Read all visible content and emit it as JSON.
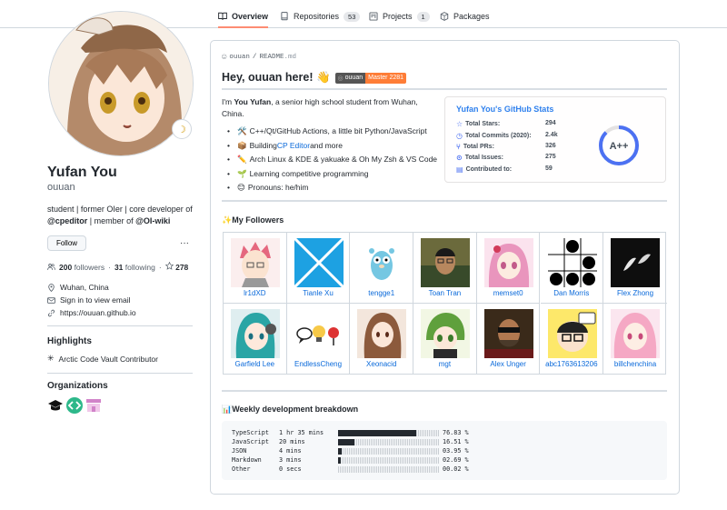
{
  "tabs": [
    {
      "label": "Overview",
      "icon": "book-icon"
    },
    {
      "label": "Repositories",
      "count": "53",
      "icon": "repo-icon"
    },
    {
      "label": "Projects",
      "count": "1",
      "icon": "project-icon"
    },
    {
      "label": "Packages",
      "icon": "package-icon"
    }
  ],
  "profile": {
    "name": "Yufan You",
    "login": "ouuan",
    "bio_pre": "student | former OIer | core developer of ",
    "bio_org1": "@cpeditor",
    "bio_mid": " | member of ",
    "bio_org2": "@OI-wiki",
    "follow_label": "Follow",
    "more_label": "···",
    "followers": "200",
    "followers_label": "followers",
    "sep": "·",
    "following": "31",
    "following_label": "following",
    "stars": "278",
    "location": "Wuhan, China",
    "email": "Sign in to view email",
    "website": "https://ouuan.github.io"
  },
  "highlights": {
    "title": "Highlights",
    "items": [
      "Arctic Code Vault Contributor"
    ]
  },
  "organizations": {
    "title": "Organizations"
  },
  "readme": {
    "path_user": "ouuan",
    "path_sep": "/",
    "path_file": "README",
    "path_ext": ".md",
    "hello": "Hey, ouuan here! 👋",
    "badge_left": "ouuan",
    "badge_right": "Master 2281",
    "intro_pre": "I'm ",
    "intro_name": "You Yufan",
    "intro_post": ", a senior high school student from Wuhan, China.",
    "bullets": [
      {
        "emoji": "🛠️",
        "text": "C++/Qt/GitHub Actions, a little bit Python/JavaScript"
      },
      {
        "emoji": "📦",
        "text_pre": "Building ",
        "link": "CP Editor",
        "text_post": " and more"
      },
      {
        "emoji": "✏️",
        "text": "Arch Linux & KDE & yakuake & Oh My Zsh & VS Code"
      },
      {
        "emoji": "🌱",
        "text": "Learning competitive programming"
      },
      {
        "emoji": "😊",
        "text": "Pronouns: he/him"
      }
    ]
  },
  "stats_card": {
    "title": "Yufan You's GitHub Stats",
    "rows": [
      {
        "label": "Total Stars:",
        "value": "294"
      },
      {
        "label": "Total Commits (2020):",
        "value": "2.4k"
      },
      {
        "label": "Total PRs:",
        "value": "326"
      },
      {
        "label": "Total Issues:",
        "value": "275"
      },
      {
        "label": "Contributed to:",
        "value": "59"
      }
    ],
    "grade": "A++",
    "accent": "#2f80ed",
    "ring": "#4c71f2"
  },
  "followers_section": {
    "title": "✨My Followers",
    "items": [
      {
        "name": "lr1dXD"
      },
      {
        "name": "Tianle Xu"
      },
      {
        "name": "tengge1"
      },
      {
        "name": "Toan Tran"
      },
      {
        "name": "memset0"
      },
      {
        "name": "Dan Morris"
      },
      {
        "name": "Flex Zhong"
      },
      {
        "name": "Garfield Lee"
      },
      {
        "name": "EndlessCheng"
      },
      {
        "name": "Xeonacid"
      },
      {
        "name": "mgt"
      },
      {
        "name": "Alex Unger"
      },
      {
        "name": "abc1763613206"
      },
      {
        "name": "billchenchina"
      }
    ]
  },
  "weekly": {
    "title": "📊Weekly development breakdown",
    "rows": [
      {
        "lang": "TypeScript",
        "time": "1 hr 35 mins",
        "percent": "76.83 %",
        "fraction": 0.7683
      },
      {
        "lang": "JavaScript",
        "time": "20 mins",
        "percent": "16.51 %",
        "fraction": 0.1651
      },
      {
        "lang": "JSON",
        "time": "4 mins",
        "percent": "03.95 %",
        "fraction": 0.0395
      },
      {
        "lang": "Markdown",
        "time": "3 mins",
        "percent": "02.69 %",
        "fraction": 0.0269
      },
      {
        "lang": "Other",
        "time": "0 secs",
        "percent": "00.02 %",
        "fraction": 0.0002
      }
    ]
  },
  "colors": {
    "link": "#0969da",
    "tab_underline": "#fd8c73",
    "border": "#d0d7de"
  }
}
